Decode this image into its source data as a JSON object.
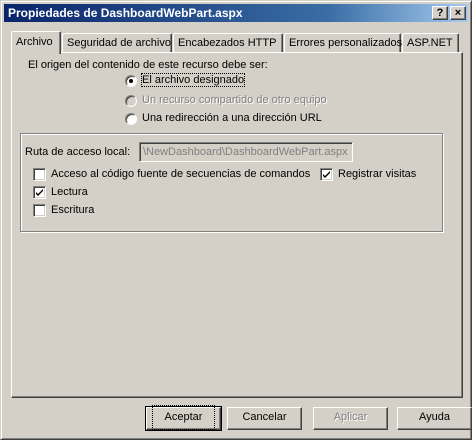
{
  "window": {
    "title": "Propiedades de DashboardWebPart.aspx",
    "help_glyph": "?",
    "close_glyph": "×"
  },
  "tabs": [
    {
      "label": "Archivo",
      "active": true
    },
    {
      "label": "Seguridad de archivo",
      "active": false
    },
    {
      "label": "Encabezados HTTP",
      "active": false
    },
    {
      "label": "Errores personalizados",
      "active": false
    },
    {
      "label": "ASP.NET",
      "active": false
    }
  ],
  "content_source": {
    "label": "El origen del contenido de este recurso debe ser:",
    "options": [
      {
        "label": "El archivo designado",
        "selected": true,
        "enabled": true
      },
      {
        "label": "Un recurso compartido de otro equipo",
        "selected": false,
        "enabled": false
      },
      {
        "label": "Una redirección a una dirección URL",
        "selected": false,
        "enabled": true
      }
    ]
  },
  "local_path": {
    "label": "Ruta de acceso local:",
    "value": "\\NewDashboard\\DashboardWebPart.aspx"
  },
  "permissions": {
    "script_source_access": {
      "label": "Acceso al código fuente de secuencias de comandos",
      "checked": false
    },
    "read": {
      "label": "Lectura",
      "checked": true
    },
    "write": {
      "label": "Escritura",
      "checked": false
    },
    "log_visits": {
      "label": "Registrar visitas",
      "checked": true
    }
  },
  "buttons": {
    "ok": "Aceptar",
    "cancel": "Cancelar",
    "apply": "Aplicar",
    "help": "Ayuda"
  }
}
